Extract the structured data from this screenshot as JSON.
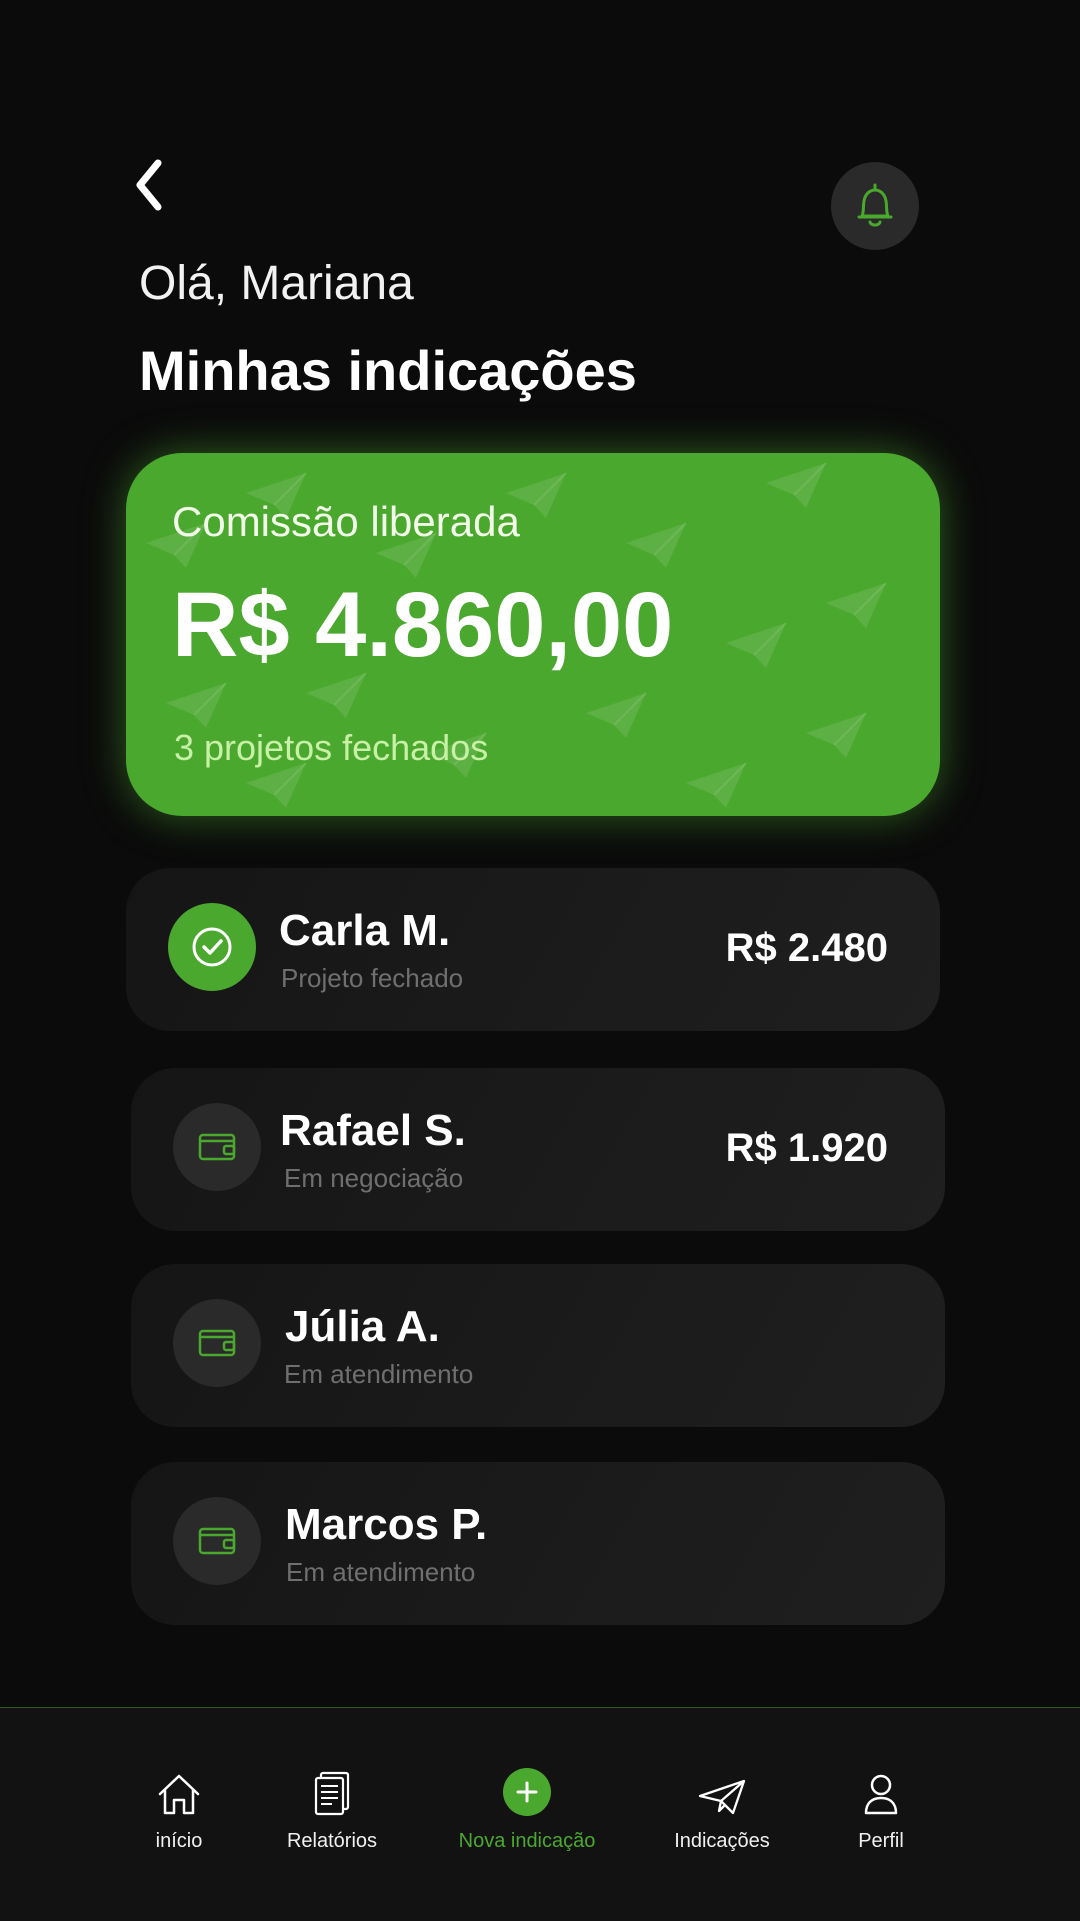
{
  "header": {
    "greeting": "Olá, Mariana",
    "title": "Minhas indicações"
  },
  "commission": {
    "label": "Comissão liberada",
    "amount": "R$ 4.860,00",
    "subtitle": "3 projetos fechados"
  },
  "referrals": [
    {
      "name": "Carla M.",
      "status": "Projeto fechado",
      "value": "R$ 2.480",
      "icon": "check-icon"
    },
    {
      "name": "Rafael S.",
      "status": "Em negociação",
      "value": "R$ 1.920",
      "icon": "wallet-icon"
    },
    {
      "name": "Júlia A.",
      "status": "Em atendimento",
      "value": "",
      "icon": "wallet-icon"
    },
    {
      "name": "Marcos P.",
      "status": "Em atendimento",
      "value": "",
      "icon": "wallet-icon"
    }
  ],
  "nav": {
    "items": [
      {
        "label": "início",
        "icon": "home-icon"
      },
      {
        "label": "Relatórios",
        "icon": "document-icon"
      },
      {
        "label": "Nova indicação",
        "icon": "plus-icon"
      },
      {
        "label": "Indicações",
        "icon": "paper-plane-icon"
      },
      {
        "label": "Perfil",
        "icon": "user-icon"
      }
    ]
  },
  "colors": {
    "accent": "#4ba82e",
    "background": "#0b0b0b",
    "card": "#1b1b1b"
  }
}
